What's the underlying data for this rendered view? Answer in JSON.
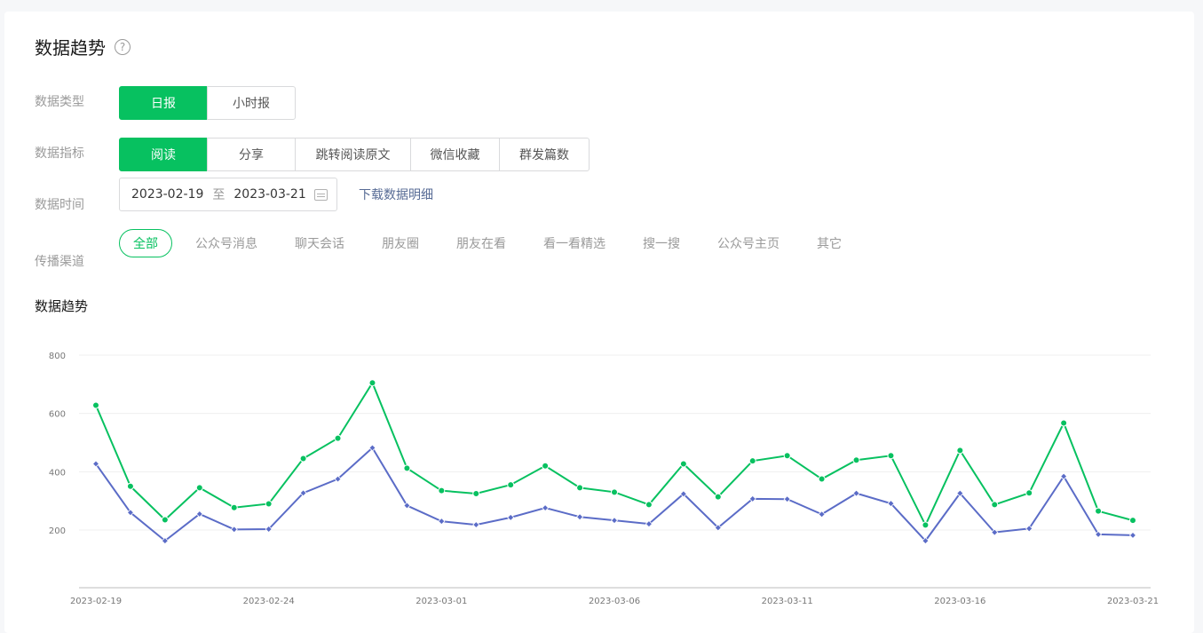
{
  "header": {
    "title": "数据趋势",
    "help_icon": "?"
  },
  "data_type": {
    "label": "数据类型",
    "options": [
      "日报",
      "小时报"
    ],
    "selected": 0
  },
  "metric": {
    "label": "数据指标",
    "options": [
      "阅读",
      "分享",
      "跳转阅读原文",
      "微信收藏",
      "群发篇数"
    ],
    "selected": 0
  },
  "time": {
    "label": "数据时间",
    "start": "2023-02-19",
    "sep": "至",
    "end": "2023-03-21",
    "download": "下载数据明细"
  },
  "channel": {
    "label": "传播渠道",
    "options": [
      "全部",
      "公众号消息",
      "聊天会话",
      "朋友圈",
      "朋友在看",
      "看一看精选",
      "搜一搜",
      "公众号主页",
      "其它"
    ],
    "selected": 0
  },
  "chart_title": "数据趋势",
  "colors": {
    "accent": "#07c160",
    "series_green": "#07c160",
    "series_blue": "#5b6cc7"
  },
  "chart_data": {
    "type": "line",
    "yticks": [
      200,
      400,
      600,
      800
    ],
    "ylim": [
      0,
      800
    ],
    "xtick_labels": [
      "2023-02-19",
      "2023-02-24",
      "2023-03-01",
      "2023-03-06",
      "2023-03-11",
      "2023-03-16",
      "2023-03-21"
    ],
    "x": [
      "2023-02-19",
      "2023-02-20",
      "2023-02-21",
      "2023-02-22",
      "2023-02-23",
      "2023-02-24",
      "2023-02-25",
      "2023-02-26",
      "2023-02-27",
      "2023-02-28",
      "2023-03-01",
      "2023-03-02",
      "2023-03-03",
      "2023-03-04",
      "2023-03-05",
      "2023-03-06",
      "2023-03-07",
      "2023-03-08",
      "2023-03-09",
      "2023-03-10",
      "2023-03-11",
      "2023-03-12",
      "2023-03-13",
      "2023-03-14",
      "2023-03-15",
      "2023-03-16",
      "2023-03-17",
      "2023-03-18",
      "2023-03-19",
      "2023-03-20",
      "2023-03-21"
    ],
    "series": [
      {
        "values": [
          628,
          350,
          235,
          345,
          277,
          290,
          445,
          515,
          705,
          412,
          335,
          325,
          355,
          420,
          345,
          330,
          287,
          427,
          314,
          437,
          455,
          375,
          440,
          455,
          217,
          473,
          287,
          327,
          567,
          265,
          233
        ]
      },
      {
        "values": [
          427,
          260,
          163,
          255,
          202,
          203,
          327,
          375,
          482,
          284,
          230,
          218,
          243,
          276,
          245,
          233,
          221,
          324,
          208,
          307,
          306,
          254,
          326,
          291,
          163,
          326,
          192,
          205,
          384,
          185,
          182
        ]
      }
    ]
  }
}
